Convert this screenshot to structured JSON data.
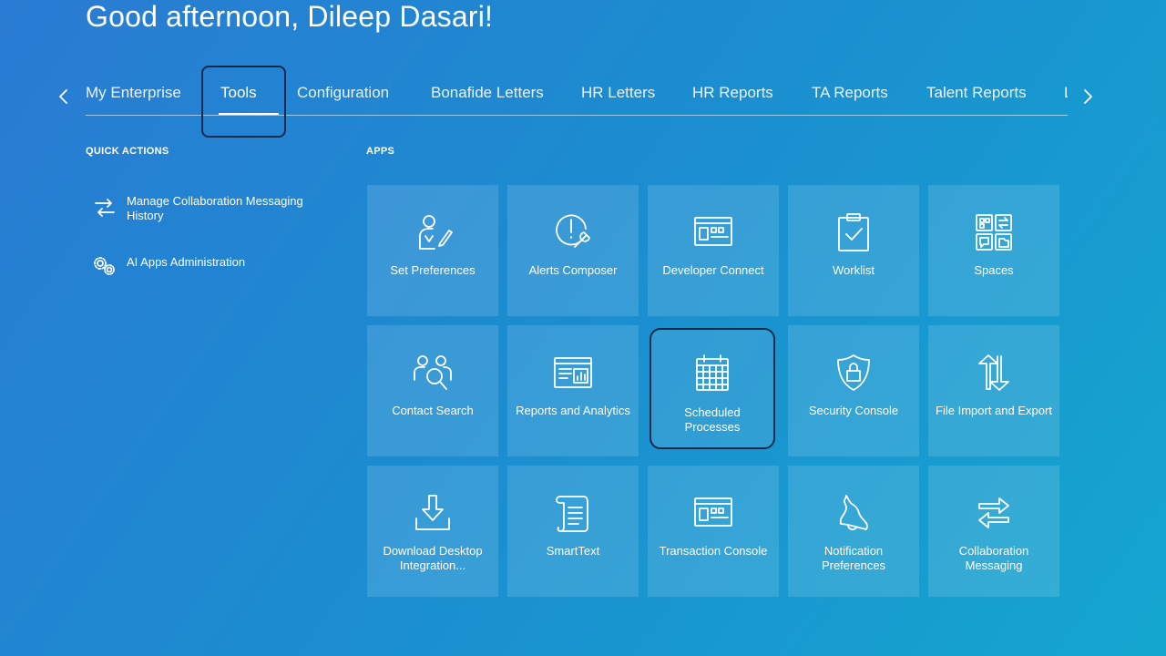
{
  "greeting": "Good afternoon, Dileep Dasari!",
  "tabs": [
    {
      "label": "My Enterprise",
      "active": false
    },
    {
      "label": "Tools",
      "active": true
    },
    {
      "label": "Configuration",
      "active": false
    },
    {
      "label": "Bonafide Letters",
      "active": false
    },
    {
      "label": "HR Letters",
      "active": false
    },
    {
      "label": "HR Reports",
      "active": false
    },
    {
      "label": "TA Reports",
      "active": false
    },
    {
      "label": "Talent Reports",
      "active": false
    },
    {
      "label": "L",
      "active": false
    }
  ],
  "quick_actions": {
    "title": "QUICK ACTIONS",
    "items": [
      {
        "label": "Manage Collaboration Messaging History",
        "icon": "arrows-exchange-icon"
      },
      {
        "label": "AI Apps Administration",
        "icon": "gears-icon"
      }
    ]
  },
  "apps": {
    "title": "APPS",
    "tiles": [
      {
        "label": "Set Preferences",
        "icon": "user-preferences-icon"
      },
      {
        "label": "Alerts Composer",
        "icon": "alert-wrench-icon"
      },
      {
        "label": "Developer Connect",
        "icon": "developer-window-icon"
      },
      {
        "label": "Worklist",
        "icon": "clipboard-check-icon"
      },
      {
        "label": "Spaces",
        "icon": "spaces-grid-icon"
      },
      {
        "label": "Contact Search",
        "icon": "contact-search-icon"
      },
      {
        "label": "Reports and Analytics",
        "icon": "report-chart-icon"
      },
      {
        "label": "Scheduled Processes",
        "icon": "calendar-icon"
      },
      {
        "label": "Security Console",
        "icon": "shield-lock-icon"
      },
      {
        "label": "File Import and Export",
        "icon": "up-down-arrows-icon"
      },
      {
        "label": "Download Desktop Integration...",
        "icon": "download-icon"
      },
      {
        "label": "SmartText",
        "icon": "scroll-text-icon"
      },
      {
        "label": "Transaction Console",
        "icon": "transaction-window-icon"
      },
      {
        "label": "Notification Preferences",
        "icon": "bell-icon"
      },
      {
        "label": "Collaboration Messaging",
        "icon": "arrows-exchange-icon"
      }
    ]
  }
}
